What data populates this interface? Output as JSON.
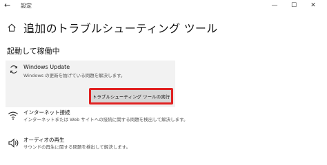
{
  "window": {
    "title": "設定",
    "back_glyph": "←",
    "minimize_glyph": "—",
    "maximize_glyph": "☐",
    "close_glyph": "✕"
  },
  "page": {
    "title": "追加のトラブルシューティング ツール",
    "section_title": "起動して稼働中"
  },
  "running_panel": {
    "name": "Windows Update",
    "description": "Windows の更新を妨げている問題を解決します。",
    "button_label": "トラブルシューティング ツールの実行",
    "highlight_color": "#e02020"
  },
  "items": [
    {
      "name": "インターネット接続",
      "description": "インターネットまたは Web サイトへの接続に関する問題を検出して解決します。",
      "icon": "wifi-icon"
    },
    {
      "name": "オーディオの再生",
      "description": "サウンドの再生に関する問題を検出して解決します。",
      "icon": "speaker-icon"
    }
  ]
}
